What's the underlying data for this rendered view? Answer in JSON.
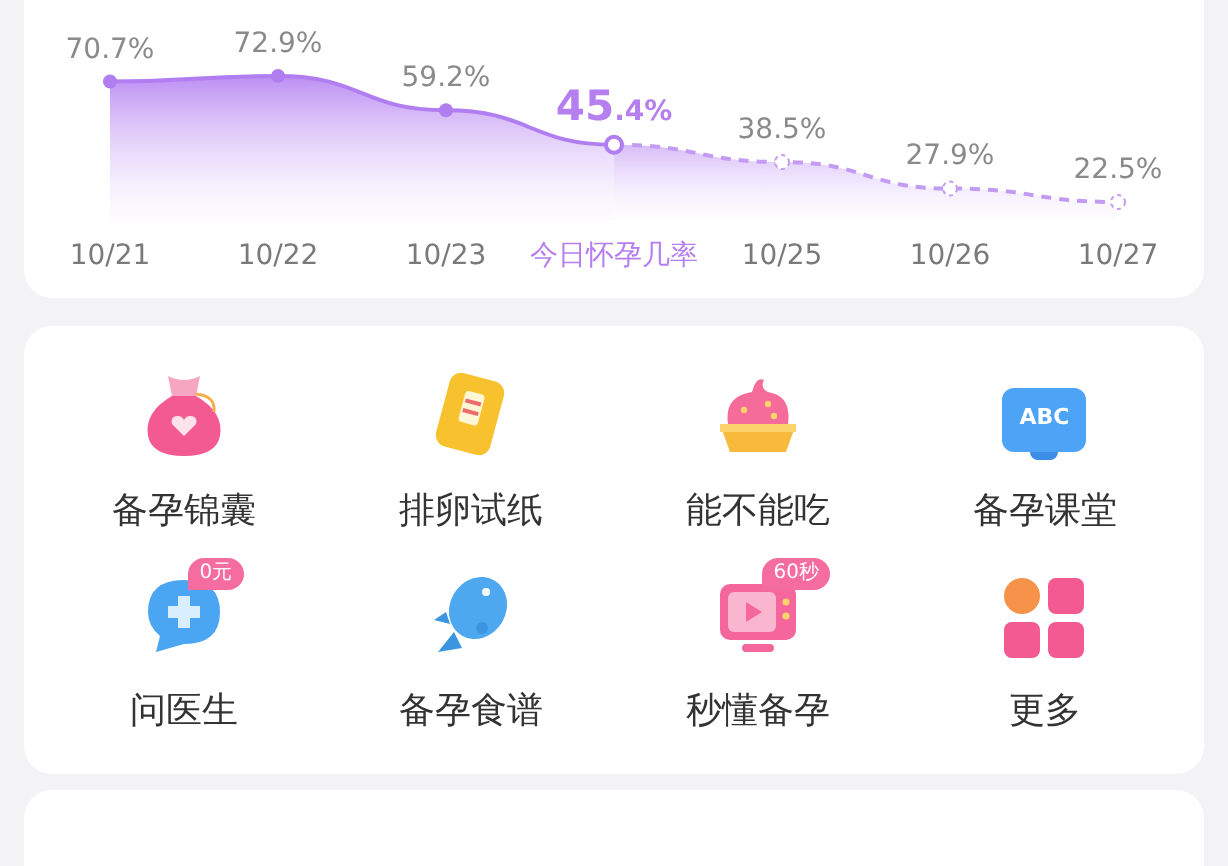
{
  "trend_card": {
    "chart_data": {
      "type": "area",
      "categories": [
        "10/21",
        "10/22",
        "10/23",
        "今日怀孕几率",
        "10/25",
        "10/26",
        "10/27"
      ],
      "series": [
        {
          "color": "#b07ef0",
          "values": [
            70.7,
            72.9,
            59.2,
            45.4,
            null,
            null,
            null
          ],
          "value_labels": [
            "70.7%",
            "72.9%",
            "59.2%",
            "45.4%",
            null,
            null,
            null
          ]
        },
        {
          "color": "#c39bf2",
          "values": [
            null,
            null,
            null,
            45.4,
            38.5,
            27.9,
            22.5
          ],
          "value_labels": [
            null,
            null,
            null,
            null,
            "38.5%",
            "27.9%",
            "22.5%"
          ]
        }
      ]
    }
  },
  "tools": [
    {
      "kind": "pouch",
      "label": "备孕锦囊"
    },
    {
      "kind": "strip",
      "label": "排卵试纸"
    },
    {
      "kind": "cupcake",
      "label": "能不能吃"
    },
    {
      "kind": "screen",
      "label": "备孕课堂",
      "icon_text": "ABC"
    },
    {
      "kind": "chat",
      "label": "问医生",
      "badge": "0元"
    },
    {
      "kind": "fish",
      "label": "备孕食谱"
    },
    {
      "kind": "tv",
      "label": "秒懂备孕",
      "badge": "60秒"
    },
    {
      "kind": "grid",
      "label": "更多"
    }
  ]
}
